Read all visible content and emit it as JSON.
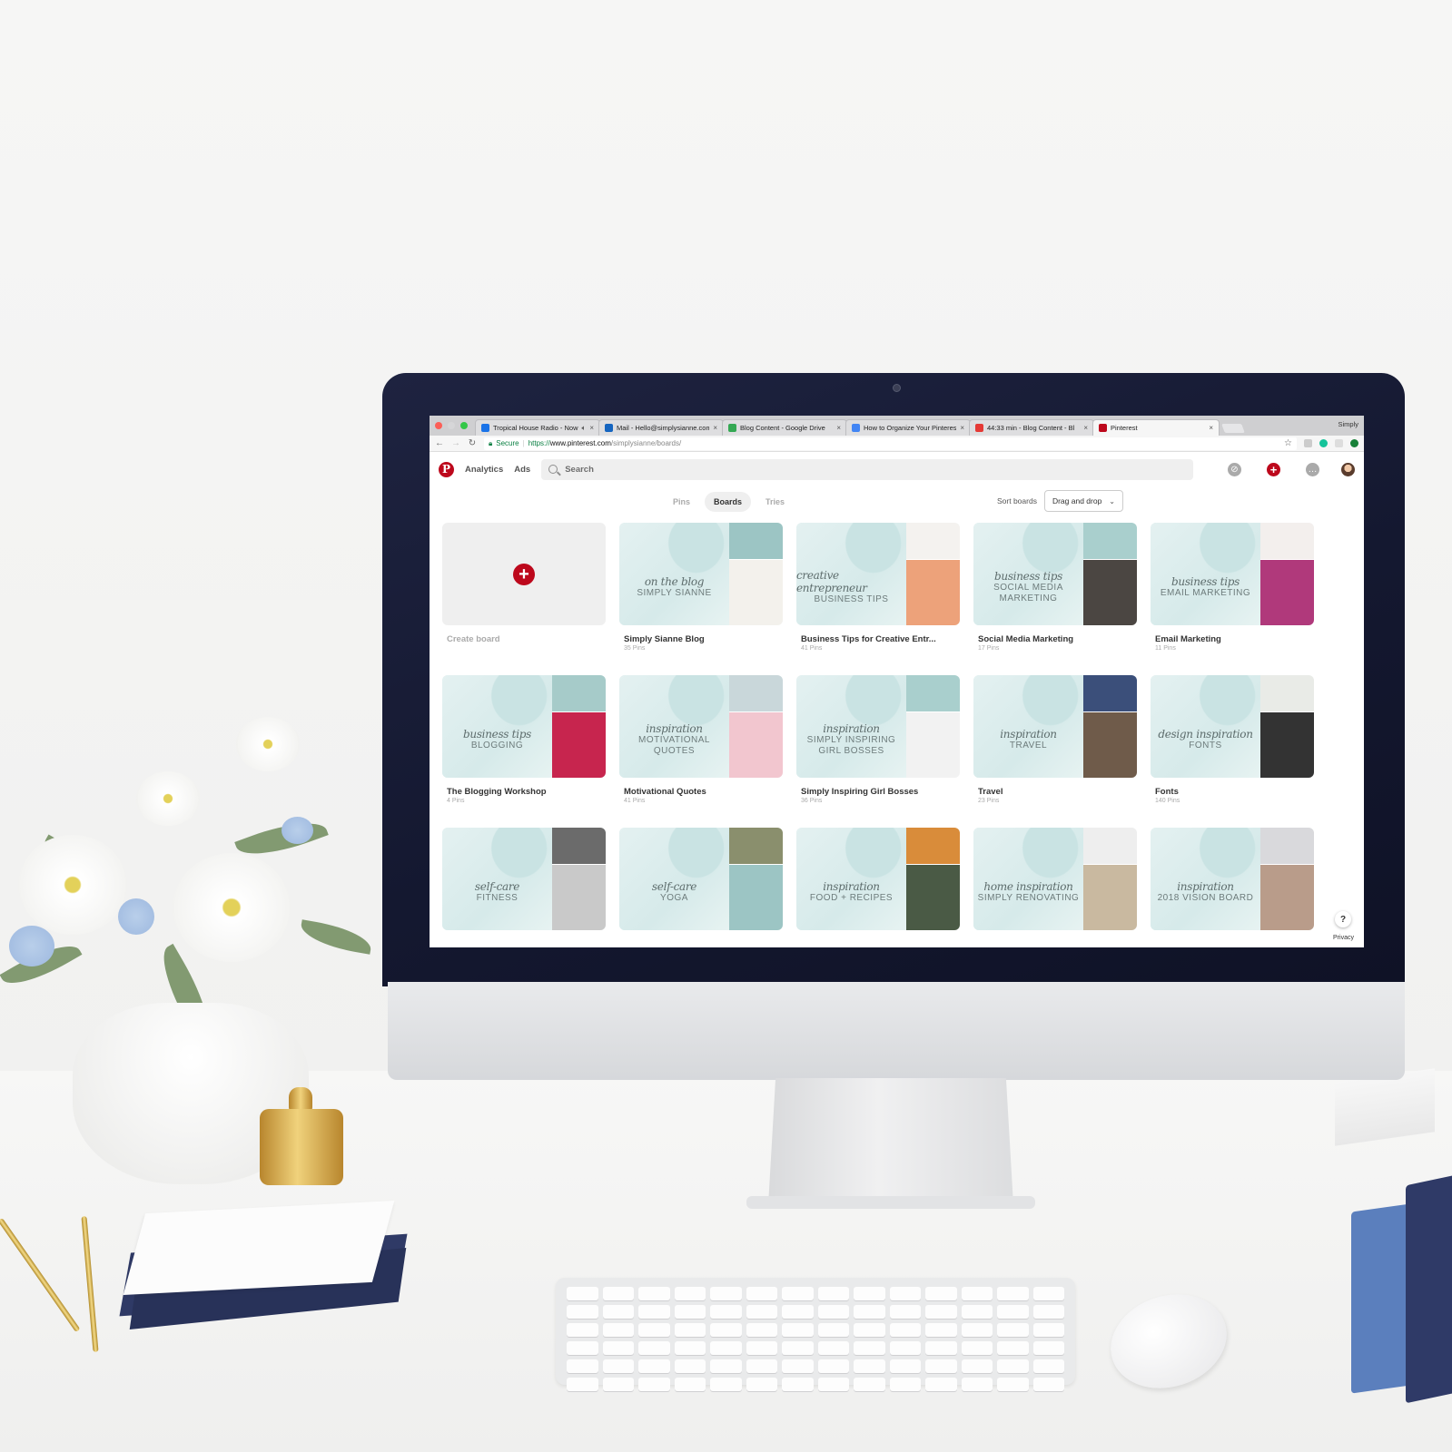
{
  "browser": {
    "tabs": [
      {
        "title": "Tropical House Radio - Now",
        "icon": "pandora-icon",
        "color": "#1a73e8",
        "audio": true
      },
      {
        "title": "Mail - Hello@simplysianne.com",
        "icon": "outlook-icon",
        "color": "#1565c0"
      },
      {
        "title": "Blog Content - Google Drive",
        "icon": "google-drive-icon",
        "color": "#34a853"
      },
      {
        "title": "How to Organize Your Pinterest",
        "icon": "google-docs-icon",
        "color": "#4285f4"
      },
      {
        "title": "44:33 min - Blog Content - Bl",
        "icon": "timer-icon",
        "color": "#e53935"
      },
      {
        "title": "Pinterest",
        "icon": "pinterest-icon",
        "color": "#bd081c",
        "active": true
      }
    ],
    "profile_name": "Simply",
    "address": {
      "secure_label": "Secure",
      "scheme": "https://",
      "host": "www.pinterest.com",
      "path": "/simplysianne/boards/"
    },
    "extensions": [
      "g-extension-icon",
      "grammarly-icon",
      "screencast-icon",
      "green-extension-icon"
    ]
  },
  "header": {
    "logo": "P",
    "nav": [
      "Analytics",
      "Ads"
    ],
    "search_placeholder": "Search",
    "icons": [
      "explore-icon",
      "add-pin-icon",
      "messages-icon",
      "profile-avatar"
    ]
  },
  "subnav": {
    "tabs": [
      {
        "label": "Pins",
        "active": false
      },
      {
        "label": "Boards",
        "active": true
      },
      {
        "label": "Tries",
        "active": false
      }
    ],
    "sort_label": "Sort boards",
    "sort_value": "Drag and drop"
  },
  "create_board": {
    "label": "Create board"
  },
  "boards": [
    {
      "title": "Simply Sianne Blog",
      "count": "35 Pins",
      "script": "on the blog",
      "caps": "SIMPLY SIANNE",
      "side": [
        "#9cc5c4",
        "#f3f1ec"
      ]
    },
    {
      "title": "Business Tips for Creative Entr...",
      "count": "41 Pins",
      "script": "creative entrepreneur",
      "caps": "BUSINESS TIPS",
      "side": [
        "#f4f2ef",
        "#eda27a"
      ]
    },
    {
      "title": "Social Media Marketing",
      "count": "17 Pins",
      "script": "business tips",
      "caps": "SOCIAL MEDIA MARKETING",
      "side": [
        "#a9cfcd",
        "#4b4642"
      ]
    },
    {
      "title": "Email Marketing",
      "count": "11 Pins",
      "script": "business tips",
      "caps": "EMAIL MARKETING",
      "side": [
        "#f3efed",
        "#b0397b"
      ]
    },
    {
      "title": "The Blogging Workshop",
      "count": "4 Pins",
      "script": "business tips",
      "caps": "BLOGGING",
      "side": [
        "#a6cbc9",
        "#c7254e"
      ]
    },
    {
      "title": "Motivational Quotes",
      "count": "41 Pins",
      "script": "inspiration",
      "caps": "MOTIVATIONAL QUOTES",
      "side": [
        "#c9d7da",
        "#f2c6cf"
      ]
    },
    {
      "title": "Simply Inspiring Girl Bosses",
      "count": "36 Pins",
      "script": "inspiration",
      "caps": "SIMPLY INSPIRING GIRL BOSSES",
      "side": [
        "#a9cfcd",
        "#f2f2f2"
      ]
    },
    {
      "title": "Travel",
      "count": "23 Pins",
      "script": "inspiration",
      "caps": "TRAVEL",
      "side": [
        "#3b4f7a",
        "#6f5b4a"
      ]
    },
    {
      "title": "Fonts",
      "count": "140 Pins",
      "script": "design inspiration",
      "caps": "FONTS",
      "side": [
        "#e9ebe7",
        "#333333"
      ]
    },
    {
      "title": "",
      "count": "",
      "script": "self-care",
      "caps": "FITNESS",
      "side": [
        "#6b6b6b",
        "#c9c9c9"
      ]
    },
    {
      "title": "",
      "count": "",
      "script": "self-care",
      "caps": "YOGA",
      "side": [
        "#8a8f6d",
        "#9cc5c4"
      ]
    },
    {
      "title": "",
      "count": "",
      "script": "inspiration",
      "caps": "FOOD + RECIPES",
      "side": [
        "#d98c3a",
        "#4a5a45"
      ]
    },
    {
      "title": "",
      "count": "",
      "script": "home inspiration",
      "caps": "SIMPLY RENOVATING",
      "side": [
        "#eeeeee",
        "#c9b9a0"
      ]
    },
    {
      "title": "",
      "count": "",
      "script": "inspiration",
      "caps": "2018 VISION BOARD",
      "side": [
        "#d9d9dc",
        "#b99c8a"
      ]
    }
  ],
  "footer": {
    "help_label": "?",
    "privacy_label": "Privacy"
  },
  "colors": {
    "brand": "#bd081c",
    "card_bg": "#dcecec"
  }
}
